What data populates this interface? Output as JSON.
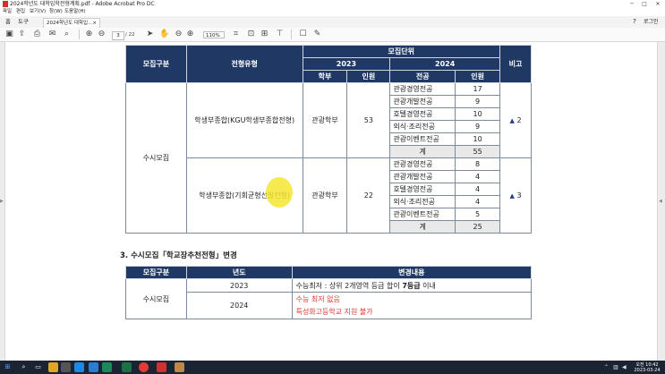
{
  "window": {
    "title": "2024학년도 대학입학전형계획.pdf - Adobe Acrobat Pro DC",
    "controls": [
      "─",
      "□",
      "✕"
    ]
  },
  "menu": [
    "파일",
    "편집",
    "보기(V)",
    "창(W)",
    "도움말(H)"
  ],
  "tabs": {
    "home": "홈",
    "tools": "도구",
    "document": "2024학년도 대학입...",
    "close": "×",
    "help": "?",
    "login": "로그인"
  },
  "toolbar": {
    "page_current": "3",
    "page_total": "/ 22",
    "zoom": "110%"
  },
  "table1": {
    "headers": {
      "category": "모집구분",
      "type": "전형유형",
      "unit": "모집단위",
      "year_a": "2023",
      "year_b": "2024",
      "dept": "학부",
      "count": "인원",
      "major": "전공",
      "count2": "인원",
      "note": "비고"
    },
    "category": "수시모집",
    "groups": [
      {
        "type": "학생부종합(KGU학생부종합전형)",
        "dept": "관광학부",
        "count2023": "53",
        "rows": [
          {
            "major": "관광경영전공",
            "count": "17"
          },
          {
            "major": "관광개발전공",
            "count": "9"
          },
          {
            "major": "호텔경영전공",
            "count": "10"
          },
          {
            "major": "외식·조리전공",
            "count": "9"
          },
          {
            "major": "관광이벤트전공",
            "count": "10"
          }
        ],
        "total_label": "계",
        "total": "55",
        "note_icon": "▲",
        "note": "2"
      },
      {
        "type": "학생부종합(기회균형선발전형)",
        "dept": "관광학부",
        "count2023": "22",
        "rows": [
          {
            "major": "관광경영전공",
            "count": "8"
          },
          {
            "major": "관광개발전공",
            "count": "4"
          },
          {
            "major": "호텔경영전공",
            "count": "4"
          },
          {
            "major": "외식·조리전공",
            "count": "4"
          },
          {
            "major": "관광이벤트전공",
            "count": "5"
          }
        ],
        "total_label": "계",
        "total": "25",
        "note_icon": "▲",
        "note": "3"
      }
    ]
  },
  "section3": {
    "title": "3. 수시모집「학교장추천전형」변경"
  },
  "table2": {
    "headers": {
      "category": "모집구분",
      "year": "년도",
      "content": "변경내용"
    },
    "category": "수시모집",
    "rows": [
      {
        "year": "2023",
        "content_pre": "수능최저 : 상위 2개영역 등급 합이 ",
        "content_bold": "7등급",
        "content_post": " 이내"
      },
      {
        "year": "2024",
        "line1": "수능 최저 없음",
        "line2": "특성화고등학교 지원 불가"
      }
    ]
  },
  "taskbar": {
    "clock_time": "오전 10:42",
    "clock_date": "2023-03-24"
  },
  "colors": {
    "header_navy": "#1f3864",
    "highlight": "#f6e633",
    "red_text": "#e53935",
    "triangle": "#1f3a8a"
  }
}
